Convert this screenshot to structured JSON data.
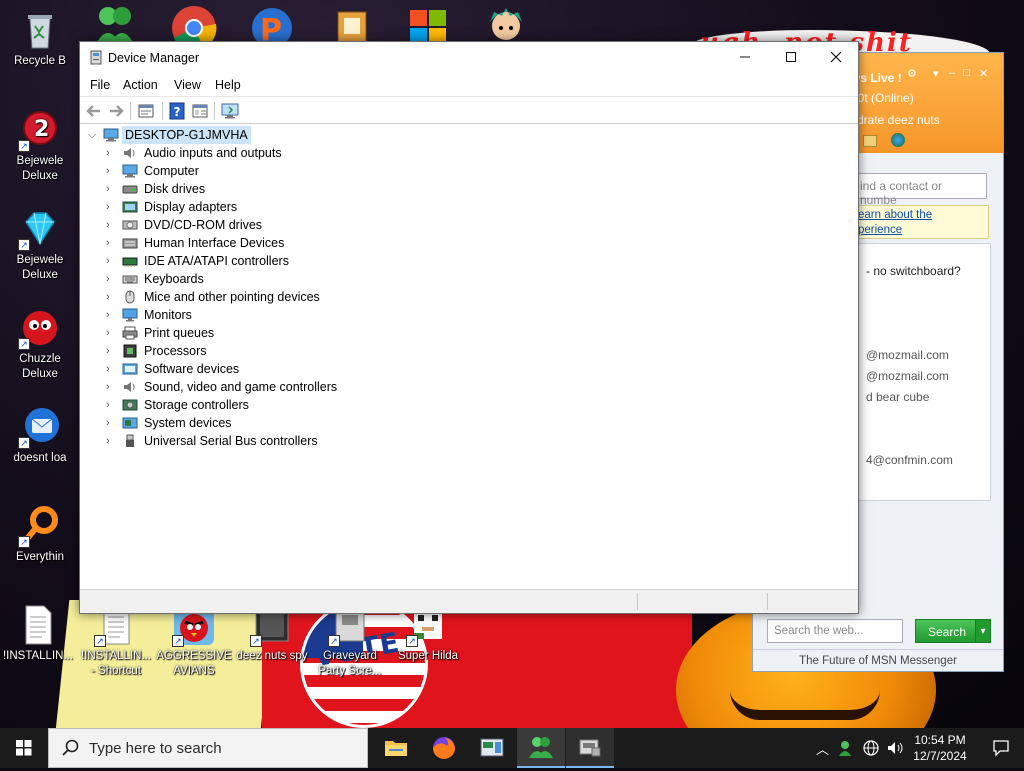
{
  "desktop": {
    "icons": [
      {
        "label": "Recycle B"
      },
      {
        "label": "Bejewele\nDeluxe"
      },
      {
        "label": "Bejewele\nDeluxe"
      },
      {
        "label": "Chuzzle\nDeluxe"
      },
      {
        "label": "doesnt loa"
      },
      {
        "label": "Everythin"
      },
      {
        "label": "!INSTALLIN..."
      },
      {
        "label": "!INSTALLIN...\n- Shortcut"
      },
      {
        "label": "AGGRESSIVE\nAVIANS"
      },
      {
        "label": "deez nuts spy"
      },
      {
        "label": "Graveyard\nParty Scre..."
      },
      {
        "label": "Super Hilda"
      }
    ],
    "wallpaper_text": "VOTE",
    "wallpaper_scribble": "ugh, not shit"
  },
  "messenger": {
    "title": "ws Live !",
    "status": "o0t  (Online)",
    "personal_message": "drate deez nuts",
    "search_placeholder": "ind a contact or numbe",
    "ad_line1": "earn about the",
    "ad_line2": "perience",
    "contacts": [
      " - no switchboard?",
      "@mozmail.com",
      "@mozmail.com",
      "d bear cube",
      "4@confmin.com"
    ],
    "web_search_placeholder": "Search the web...",
    "search_button": "Search",
    "footer": "The Future of MSN Messenger"
  },
  "device_manager": {
    "title": "Device Manager",
    "menu": [
      "File",
      "Action",
      "View",
      "Help"
    ],
    "root": "DESKTOP-G1JMVHA",
    "categories": [
      {
        "label": "Audio inputs and outputs",
        "icon": "speaker-icon"
      },
      {
        "label": "Computer",
        "icon": "computer-icon"
      },
      {
        "label": "Disk drives",
        "icon": "disk-drive-icon"
      },
      {
        "label": "Display adapters",
        "icon": "display-adapter-icon"
      },
      {
        "label": "DVD/CD-ROM drives",
        "icon": "dvd-drive-icon"
      },
      {
        "label": "Human Interface Devices",
        "icon": "hid-icon"
      },
      {
        "label": "IDE ATA/ATAPI controllers",
        "icon": "ide-controller-icon"
      },
      {
        "label": "Keyboards",
        "icon": "keyboard-icon"
      },
      {
        "label": "Mice and other pointing devices",
        "icon": "mouse-icon"
      },
      {
        "label": "Monitors",
        "icon": "monitor-icon"
      },
      {
        "label": "Print queues",
        "icon": "printer-icon"
      },
      {
        "label": "Processors",
        "icon": "processor-icon"
      },
      {
        "label": "Software devices",
        "icon": "software-device-icon"
      },
      {
        "label": "Sound, video and game controllers",
        "icon": "sound-controller-icon"
      },
      {
        "label": "Storage controllers",
        "icon": "storage-controller-icon"
      },
      {
        "label": "System devices",
        "icon": "system-device-icon"
      },
      {
        "label": "Universal Serial Bus controllers",
        "icon": "usb-icon"
      }
    ]
  },
  "taskbar": {
    "search_placeholder": "Type here to search",
    "time": "10:54 PM",
    "date": "12/7/2024"
  },
  "colors": {
    "selection": "#cce4f7",
    "taskbar": "#1b1b1b",
    "msn_orange": "#f6962a",
    "accent": "#7ab8f5"
  }
}
